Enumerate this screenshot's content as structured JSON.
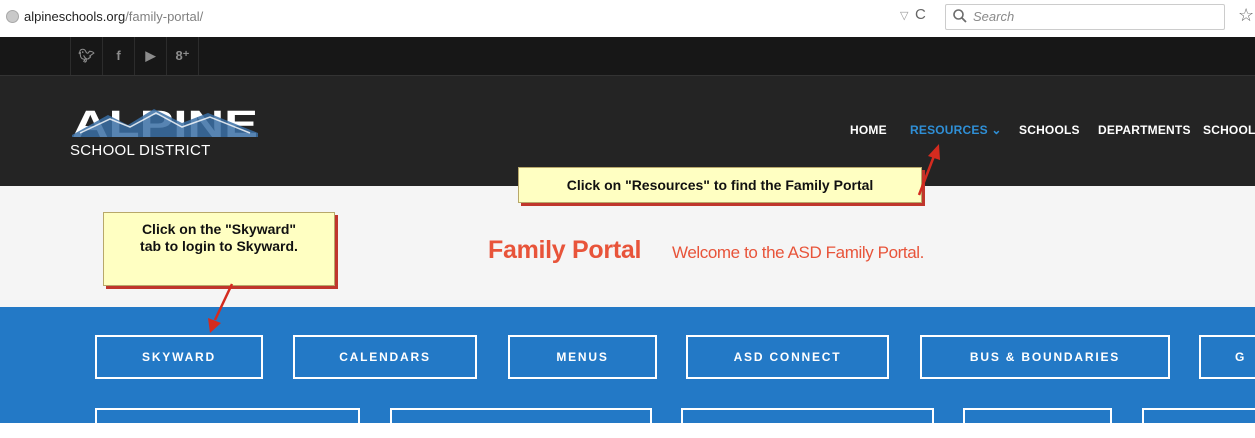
{
  "browser": {
    "url_host": "alpineschools.org",
    "url_path": "/family-portal/",
    "search_placeholder": "Search",
    "dropdown_icon": "▽",
    "reload_icon": "C",
    "star_icon": "☆"
  },
  "social": [
    {
      "name": "twitter-icon",
      "glyph": "🐦︎"
    },
    {
      "name": "facebook-icon",
      "glyph": "f"
    },
    {
      "name": "youtube-icon",
      "glyph": "▶"
    },
    {
      "name": "google-plus-icon",
      "glyph": "8⁺"
    }
  ],
  "logo": {
    "text": "ALPINE",
    "subtitle": "SCHOOL DISTRICT"
  },
  "nav": {
    "items": [
      "HOME",
      "RESOURCES",
      "SCHOOLS",
      "DEPARTMENTS",
      "SCHOOL"
    ],
    "active": "RESOURCES",
    "chevron": "⌄"
  },
  "portal": {
    "title": "Family Portal",
    "subtitle": "Welcome to the ASD Family Portal."
  },
  "tabs": [
    "SKYWARD",
    "CALENDARS",
    "MENUS",
    "ASD CONNECT",
    "BUS & BOUNDARIES",
    "G"
  ],
  "callouts": {
    "resources": "Click on \"Resources\" to  find the Family Portal",
    "skyward_line1": "Click on the \"Skyward\"",
    "skyward_line2": "tab to login to Skyward."
  },
  "colors": {
    "nav_active": "#2f8fd6",
    "portal_title": "#e8543a",
    "tab_area": "#2379c6",
    "header_bg": "#242424",
    "callout_bg": "#ffffc2",
    "arrow": "#d42b1f"
  }
}
